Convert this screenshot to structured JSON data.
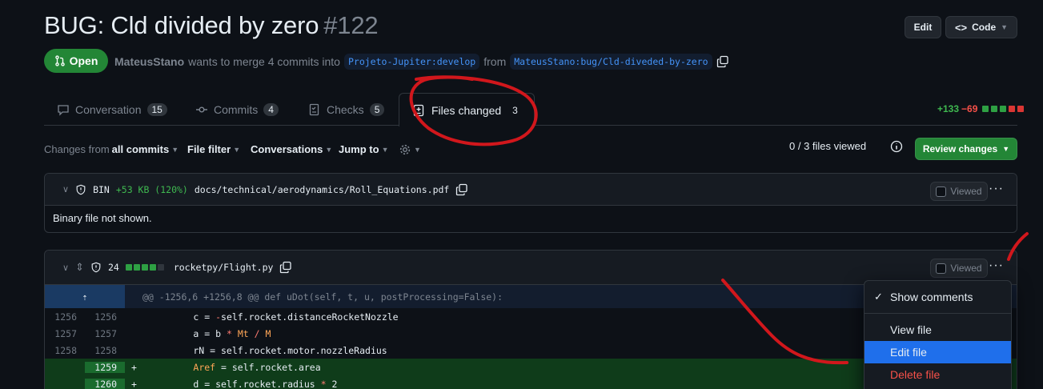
{
  "pr": {
    "title": "BUG: Cld divided by zero",
    "number": "#122",
    "status": "Open",
    "author": "MateusStano",
    "merge_text": "wants to merge 4 commits into",
    "base_branch": "Projeto-Jupiter:develop",
    "from_text": "from",
    "head_branch": "MateusStano:bug/Cld-diveded-by-zero"
  },
  "header_buttons": {
    "edit": "Edit",
    "code": "Code"
  },
  "tabs": [
    {
      "label": "Conversation",
      "count": "15",
      "icon": "comment-icon"
    },
    {
      "label": "Commits",
      "count": "4",
      "icon": "commit-icon"
    },
    {
      "label": "Checks",
      "count": "5",
      "icon": "checklist-icon"
    },
    {
      "label": "Files changed",
      "count": "3",
      "icon": "file-diff-icon"
    }
  ],
  "diffstat": {
    "additions": "+133",
    "deletions": "−69"
  },
  "toolbar": {
    "changes_from": "Changes from",
    "all_commits": "all commits",
    "file_filter": "File filter",
    "conversations": "Conversations",
    "jump_to": "Jump to",
    "files_viewed": "0 / 3 files viewed",
    "review_changes": "Review changes"
  },
  "files": [
    {
      "badge": "BIN",
      "size_delta": "+53 KB (120%)",
      "path": "docs/technical/aerodynamics/Roll_Equations.pdf",
      "viewed_label": "Viewed",
      "note": "Binary file not shown."
    },
    {
      "changes": "24",
      "path": "rocketpy/Flight.py",
      "viewed_label": "Viewed",
      "hunk_header": "@@ -1256,6 +1256,8 @@ def uDot(self, t, u, postProcessing=False):",
      "lines": [
        {
          "old": "1256",
          "new": "1256",
          "sign": "",
          "code": "        c = -self.rocket.distanceRocketNozzle"
        },
        {
          "old": "1257",
          "new": "1257",
          "sign": "",
          "code": "        a = b * Mt / M"
        },
        {
          "old": "1258",
          "new": "1258",
          "sign": "",
          "code": "        rN = self.rocket.motor.nozzleRadius"
        },
        {
          "old": "",
          "new": "1259",
          "sign": "+",
          "code": "        Aref = self.rocket.area"
        },
        {
          "old": "",
          "new": "1260",
          "sign": "+",
          "code": "        d = self.rocket.radius * 2"
        }
      ]
    }
  ],
  "menu": {
    "show_comments": "Show comments",
    "view_file": "View file",
    "edit_file": "Edit file",
    "delete_file": "Delete file"
  },
  "colors": {
    "open_green": "#238636",
    "link_blue": "#4493f8",
    "annotation_red": "#d1171c",
    "menu_selected": "#1f6feb"
  }
}
